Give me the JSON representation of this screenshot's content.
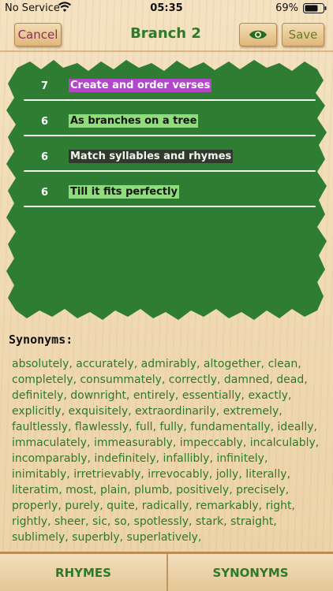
{
  "status": {
    "carrier": "No Service",
    "time": "05:35",
    "battery": "69%"
  },
  "nav": {
    "cancel_label": "Cancel",
    "title": "Branch 2",
    "save_label": "Save"
  },
  "verses": [
    {
      "syllables": "7",
      "text": "Create and order verses",
      "highlight": "purple"
    },
    {
      "syllables": "6",
      "text": "As branches on a tree",
      "highlight": "lightgreen"
    },
    {
      "syllables": "6",
      "text": "Match syllables and rhymes",
      "highlight": "dark"
    },
    {
      "syllables": "6",
      "text": "Till it fits perfectly",
      "highlight": "lightgreen"
    }
  ],
  "synonyms": {
    "title": "Synonyms:",
    "text": "absolutely, accurately, admirably, altogether, clean, completely, consummately, correctly, damned, dead, definitely, downright, entirely, essentially, exactly, explicitly, exquisitely, extraordinarily, extremely, faultlessly, flawlessly, full, fully, fundamentally, ideally, immaculately, immeasurably, impeccably, incalculably, incomparably, indefinitely, infallibly, infinitely, inimitably, irretrievably, irrevocably, jolly, literally, literatim, most, plain, plumb, positively, precisely, properly, purely, quite, radically, remarkably, right, rightly, sheer, sic, so, spotlessly, stark, straight, sublimely, superbly, superlatively,"
  },
  "tabs": {
    "rhymes": "RHYMES",
    "synonyms": "SYNONYMS"
  },
  "colors": {
    "board_green": "#2e7d32",
    "accent_green": "#2d7a29",
    "cancel_text": "#8a2f5a"
  },
  "icons": {
    "eye_button": "eye-icon",
    "wifi": "wifi-icon",
    "battery": "battery-icon"
  }
}
